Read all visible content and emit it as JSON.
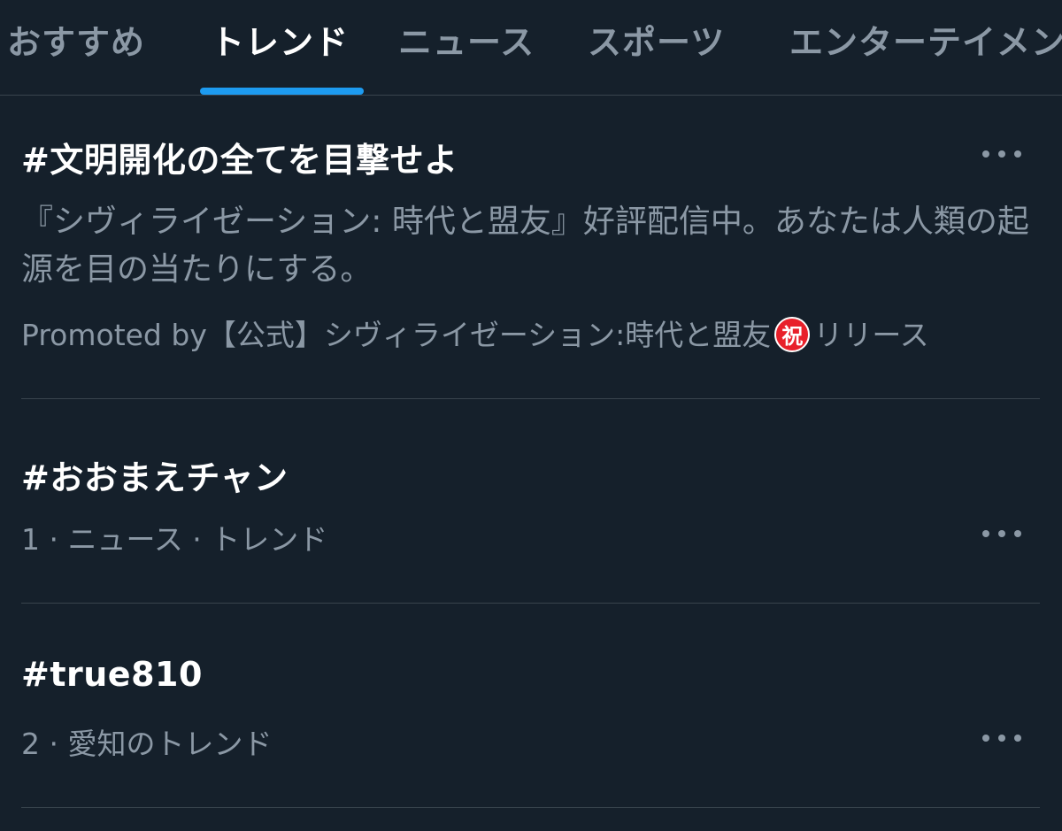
{
  "tabs": [
    {
      "label": "おすすめ",
      "active": false
    },
    {
      "label": "トレンド",
      "active": true
    },
    {
      "label": "ニュース",
      "active": false
    },
    {
      "label": "スポーツ",
      "active": false
    },
    {
      "label": "エンターテイメント",
      "active": false
    }
  ],
  "trends": [
    {
      "title": "#文明開化の全てを目撃せよ",
      "description": "『シヴィライゼーション: 時代と盟友』好評配信中。あなたは人類の起源を目の当たりにする。",
      "promoted_prefix": "Promoted by【公式】シヴィライゼーション:時代と盟友",
      "promoted_badge": "祝",
      "promoted_suffix": "リリース",
      "more_icon": "more-horizontal-icon"
    },
    {
      "title": "#おおまえチャン",
      "meta": "1 · ニュース · トレンド",
      "more_icon": "more-horizontal-icon"
    },
    {
      "title": "#true810",
      "meta": "2 · 愛知のトレンド",
      "more_icon": "more-horizontal-icon"
    }
  ],
  "colors": {
    "background": "#15202b",
    "accent": "#1d9bf0",
    "primary_text": "#ffffff",
    "secondary_text": "#8b98a5",
    "divider": "#38444d",
    "badge_red": "#e8202a"
  }
}
